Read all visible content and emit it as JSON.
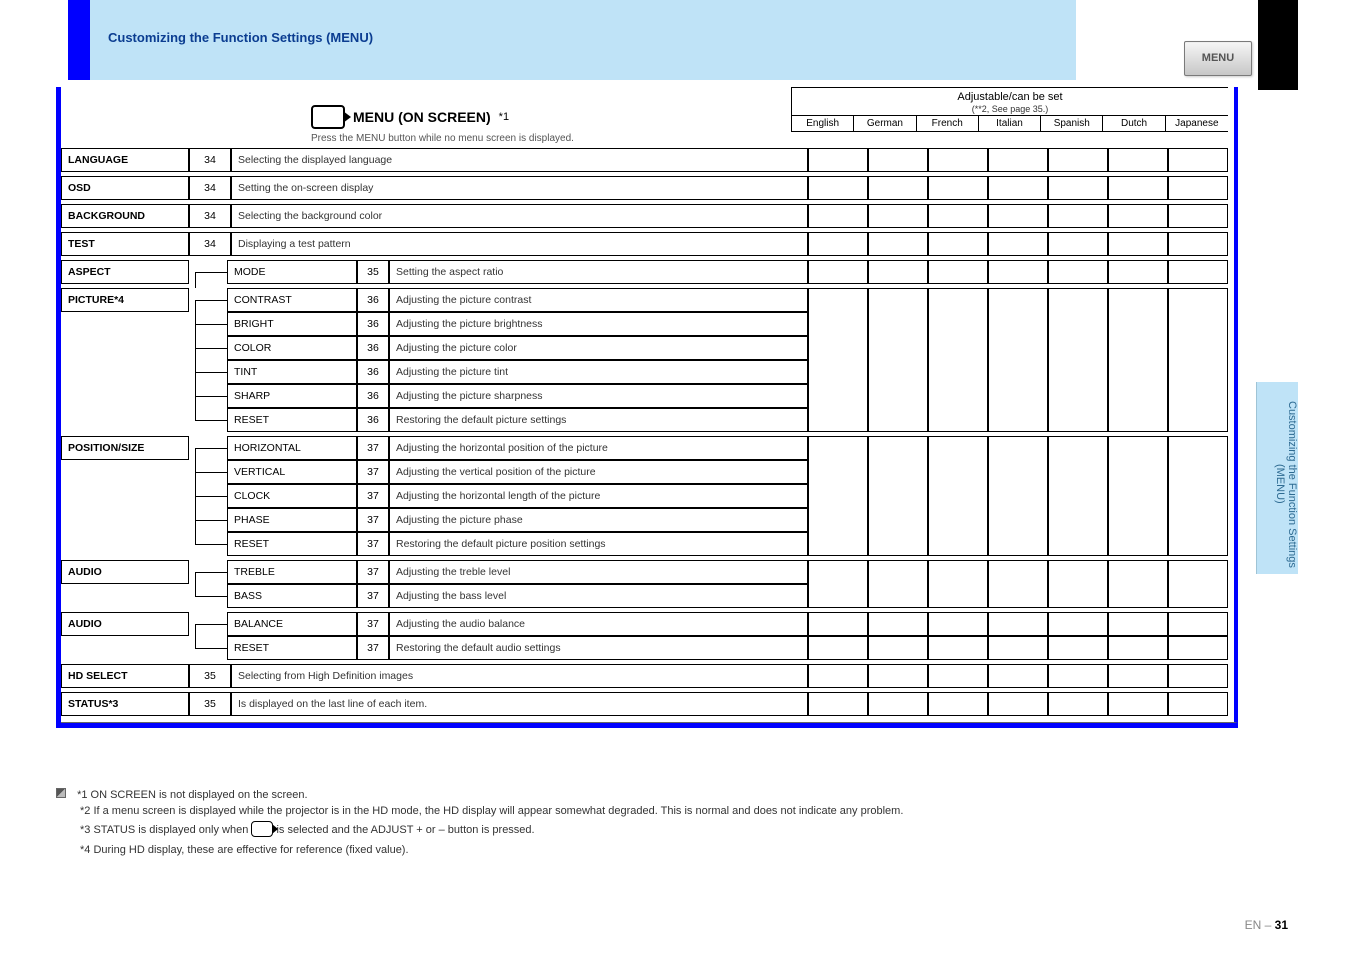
{
  "header": {
    "corner_title": "Customizing the Function Settings (MENU)",
    "button_label": "MENU",
    "side_tab": "Customizing the Function Settings (MENU)"
  },
  "table_header": {
    "title": "MENU (ON SCREEN)",
    "subtitle": "Press the MENU button while no menu screen is displayed.",
    "right_caption": "Adjustable/can be set",
    "right_caption_hint": "(**2, See page 35.)",
    "lang_columns": [
      "English",
      "German",
      "French",
      "Italian",
      "Spanish",
      "Dutch",
      "Japanese"
    ]
  },
  "rows": [
    {
      "label": "LANGUAGE",
      "page": "34",
      "desc": "Selecting the displayed language",
      "langs": [
        "",
        "",
        "",
        "",
        "",
        "",
        ""
      ]
    },
    {
      "label": "OSD",
      "page": "34",
      "desc": "Setting the on-screen display",
      "langs": [
        "",
        "",
        "",
        "",
        "",
        "",
        ""
      ]
    },
    {
      "label": "BACKGROUND",
      "page": "34",
      "desc": "Selecting the background color",
      "langs": [
        "",
        "",
        "",
        "",
        "",
        "",
        ""
      ]
    },
    {
      "label": "TEST",
      "page": "34",
      "desc": "Displaying a test pattern",
      "langs": [
        "",
        "",
        "",
        "",
        "",
        "",
        ""
      ]
    }
  ],
  "groups": [
    {
      "label": "ASPECT",
      "langs_rows": [
        [
          "",
          "",
          "",
          "",
          "",
          "",
          ""
        ]
      ],
      "children": [
        {
          "label": "MODE",
          "page": "35",
          "desc": "Setting the aspect ratio"
        }
      ]
    },
    {
      "label": "PICTURE*4",
      "langs_rows": [
        [
          "",
          "",
          "",
          "",
          "",
          "",
          ""
        ]
      ],
      "children": [
        {
          "label": "CONTRAST",
          "page": "36",
          "desc": "Adjusting the picture contrast"
        },
        {
          "label": "BRIGHT",
          "page": "36",
          "desc": "Adjusting the picture brightness"
        },
        {
          "label": "COLOR",
          "page": "36",
          "desc": "Adjusting the picture color"
        },
        {
          "label": "TINT",
          "page": "36",
          "desc": "Adjusting the picture tint"
        },
        {
          "label": "SHARP",
          "page": "36",
          "desc": "Adjusting the picture sharpness"
        },
        {
          "label": "RESET",
          "page": "36",
          "desc": "Restoring the default picture settings"
        }
      ]
    },
    {
      "label": "POSITION/SIZE",
      "langs_rows": [
        [
          "",
          "",
          "",
          "",
          "",
          "",
          ""
        ]
      ],
      "children": [
        {
          "label": "HORIZONTAL",
          "page": "37",
          "desc": "Adjusting the horizontal position of the picture"
        },
        {
          "label": "VERTICAL",
          "page": "37",
          "desc": "Adjusting the vertical position of the picture"
        },
        {
          "label": "CLOCK",
          "page": "37",
          "desc": "Adjusting the horizontal length of the picture"
        },
        {
          "label": "PHASE",
          "page": "37",
          "desc": "Adjusting the picture phase"
        },
        {
          "label": "RESET",
          "page": "37",
          "desc": "Restoring the default picture position settings"
        }
      ]
    },
    {
      "label": "AUDIO",
      "langs_rows": [
        [
          "",
          "",
          "",
          "",
          "",
          "",
          ""
        ]
      ],
      "children": [
        {
          "label": "TREBLE",
          "page": "37",
          "desc": "Adjusting the treble level"
        },
        {
          "label": "BASS",
          "page": "37",
          "desc": "Adjusting the bass level"
        }
      ]
    },
    {
      "label": "AUDIO",
      "langs_rows": [
        [
          "",
          "",
          "",
          "",
          "",
          "",
          ""
        ],
        [
          "",
          "",
          "",
          "",
          "",
          "",
          ""
        ]
      ],
      "children": [
        {
          "label": "BALANCE",
          "page": "37",
          "desc": "Adjusting the audio balance"
        },
        {
          "label": "RESET",
          "page": "37",
          "desc": "Restoring the default audio settings"
        }
      ]
    }
  ],
  "bottom_rows": [
    {
      "label": "HD SELECT",
      "page": "35",
      "desc": "Selecting from High Definition images",
      "langs": [
        "",
        "",
        "",
        "",
        "",
        "",
        ""
      ]
    },
    {
      "label": "STATUS*3",
      "page": "35",
      "desc": "Is displayed on the last line of each item.",
      "langs": [
        "",
        "",
        "",
        "",
        "",
        "",
        ""
      ]
    }
  ],
  "notes": {
    "line1": "*1 ON SCREEN is not displayed on the screen.",
    "line2": "*2 If a menu screen is displayed while the projector is in the HD mode, the HD display will appear somewhat degraded. This is normal and does not indicate any problem.",
    "line3_prefix": "*3 STATUS is displayed only when ",
    "line3_suffix": " is selected and the ADJUST + or – button is pressed.",
    "line4": "*4 During HD display, these are effective for reference (fixed value)."
  },
  "page_number": {
    "section": "EN",
    "num": "31",
    "title_side": "Customizing the Function Settings (MENU)"
  }
}
